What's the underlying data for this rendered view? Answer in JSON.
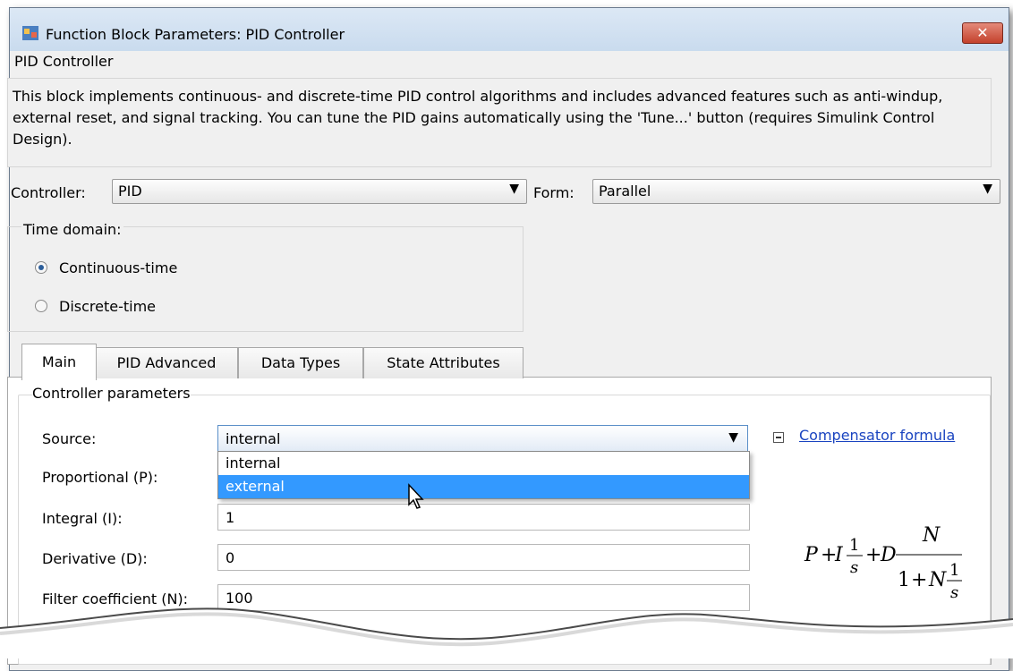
{
  "window": {
    "title": "Function Block Parameters: PID Controller",
    "close_glyph": "✕"
  },
  "header": {
    "section_title": "PID Controller",
    "description": "This block implements continuous- and discrete-time PID control algorithms and includes advanced features such as anti-windup, external reset, and signal tracking. You can tune the PID gains automatically using the 'Tune...' button (requires Simulink Control Design)."
  },
  "controller": {
    "label": "Controller:",
    "value": "PID"
  },
  "form": {
    "label": "Form:",
    "value": "Parallel"
  },
  "time_domain": {
    "label": "Time domain:",
    "options": [
      {
        "label": "Continuous-time",
        "selected": true
      },
      {
        "label": "Discrete-time",
        "selected": false
      }
    ]
  },
  "tabs": [
    {
      "label": "Main",
      "active": true
    },
    {
      "label": "PID Advanced",
      "active": false
    },
    {
      "label": "Data Types",
      "active": false
    },
    {
      "label": "State Attributes",
      "active": false
    }
  ],
  "params": {
    "group_title": "Controller parameters",
    "source": {
      "label": "Source:",
      "value": "internal",
      "options": [
        "internal",
        "external"
      ],
      "highlighted": "external"
    },
    "proportional": {
      "label": "Proportional (P):"
    },
    "integral": {
      "label": "Integral (I):",
      "value": "1"
    },
    "derivative": {
      "label": "Derivative (D):",
      "value": "0"
    },
    "filter": {
      "label": "Filter coefficient (N):",
      "value": "100"
    }
  },
  "compensator": {
    "link": "Compensator formula",
    "formula": {
      "P": "P",
      "plus1": "+",
      "I": "I",
      "one_a": "1",
      "s_a": "s",
      "plus2": "+",
      "D": "D",
      "N_num": "N",
      "one_b": "1",
      "plus3": "+",
      "N_den": "N",
      "one_c": "1",
      "s_b": "s"
    }
  },
  "colors": {
    "link": "#1a44c0",
    "highlight": "#3399ff",
    "close_button": "#c4412c"
  }
}
